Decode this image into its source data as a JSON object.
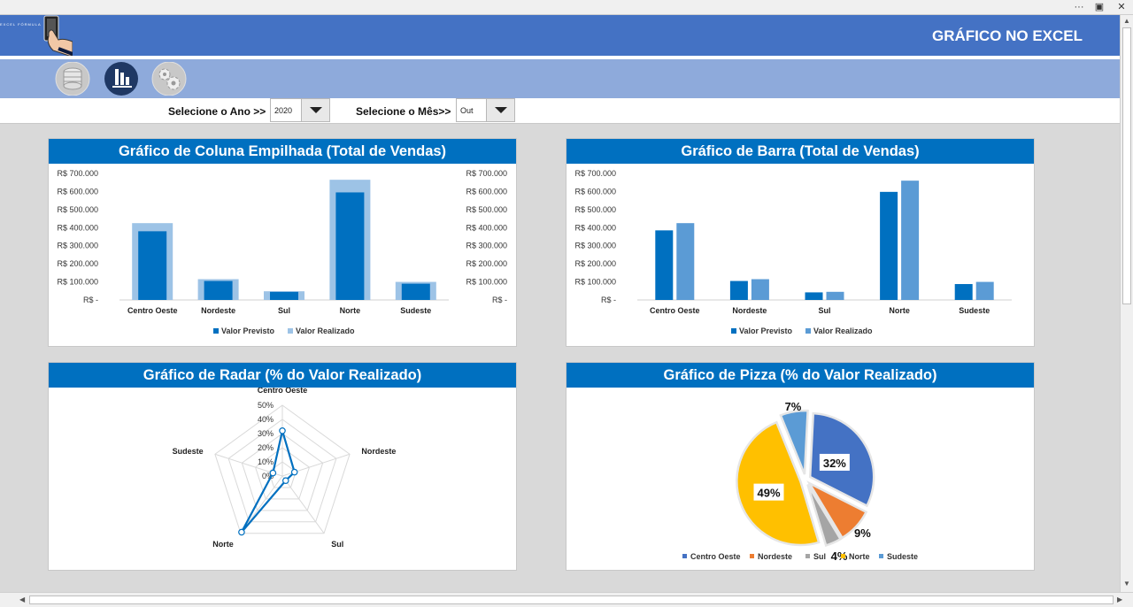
{
  "window": {
    "controls": [
      "···",
      "▣",
      "✕"
    ]
  },
  "header": {
    "title": "GRÁFICO NO EXCEL",
    "logo_text": "EXCEL FÓRMULA"
  },
  "nav_icons": [
    "database-icon",
    "bar-chart-icon",
    "settings-icon"
  ],
  "filters": {
    "year_label": "Selecione o Ano >>",
    "year_value": "2020",
    "month_label": "Selecione o Mês>>",
    "month_value": "Out"
  },
  "colors": {
    "header": "#4472c4",
    "icon_bar": "#8eaadb",
    "panel_title": "#0070c0",
    "previsto": "#0070c0",
    "realizado": "#9dc3e6",
    "realizado_bar": "#5b9bd5"
  },
  "panels": {
    "stacked": {
      "title": "Gráfico de Coluna Empilhada (Total de Vendas)"
    },
    "bar": {
      "title": "Gráfico de Barra (Total de Vendas)"
    },
    "radar": {
      "title": "Gráfico de Radar (% do Valor Realizado)"
    },
    "pie": {
      "title": "Gráfico de Pizza (% do Valor Realizado)"
    }
  },
  "chart_data": [
    {
      "type": "bar",
      "title": "Gráfico de Coluna Empilhada (Total de Vendas)",
      "categories": [
        "Centro Oeste",
        "Nordeste",
        "Sul",
        "Norte",
        "Sudeste"
      ],
      "series": [
        {
          "name": "Valor Previsto",
          "values": [
            380000,
            105000,
            45000,
            595000,
            90000
          ]
        },
        {
          "name": "Valor Realizado",
          "values": [
            425000,
            115000,
            48000,
            665000,
            100000
          ]
        }
      ],
      "y_ticks": [
        "R$ 700.000",
        "R$ 600.000",
        "R$ 500.000",
        "R$ 400.000",
        "R$ 300.000",
        "R$ 200.000",
        "R$ 100.000",
        "R$ -"
      ],
      "ylim": [
        0,
        700000
      ],
      "secondary_axis": true,
      "legend": "bottom"
    },
    {
      "type": "bar",
      "title": "Gráfico de Barra (Total de Vendas)",
      "categories": [
        "Centro Oeste",
        "Nordeste",
        "Sul",
        "Norte",
        "Sudeste"
      ],
      "series": [
        {
          "name": "Valor Previsto",
          "values": [
            385000,
            105000,
            42000,
            598000,
            88000
          ]
        },
        {
          "name": "Valor Realizado",
          "values": [
            425000,
            115000,
            45000,
            660000,
            100000
          ]
        }
      ],
      "y_ticks": [
        "R$ 700.000",
        "R$ 600.000",
        "R$ 500.000",
        "R$ 400.000",
        "R$ 300.000",
        "R$ 200.000",
        "R$ 100.000",
        "R$ -"
      ],
      "ylim": [
        0,
        700000
      ],
      "legend": "bottom"
    },
    {
      "type": "radar",
      "title": "Gráfico de Radar (% do Valor Realizado)",
      "categories": [
        "Centro Oeste",
        "Nordeste",
        "Sul",
        "Norte",
        "Sudeste"
      ],
      "values": [
        32,
        9,
        4,
        49,
        7
      ],
      "r_ticks": [
        "0%",
        "10%",
        "20%",
        "30%",
        "40%",
        "50%"
      ],
      "rlim": [
        0,
        50
      ]
    },
    {
      "type": "pie",
      "title": "Gráfico de Pizza (% do Valor Realizado)",
      "categories": [
        "Centro Oeste",
        "Nordeste",
        "Sul",
        "Norte",
        "Sudeste"
      ],
      "values": [
        32,
        9,
        4,
        49,
        7
      ],
      "labels": [
        "32%",
        "9%",
        "4%",
        "49%",
        "7%"
      ],
      "colors": [
        "#4472c4",
        "#ed7d31",
        "#a5a5a5",
        "#ffc000",
        "#5b9bd5"
      ],
      "legend": "bottom"
    }
  ]
}
